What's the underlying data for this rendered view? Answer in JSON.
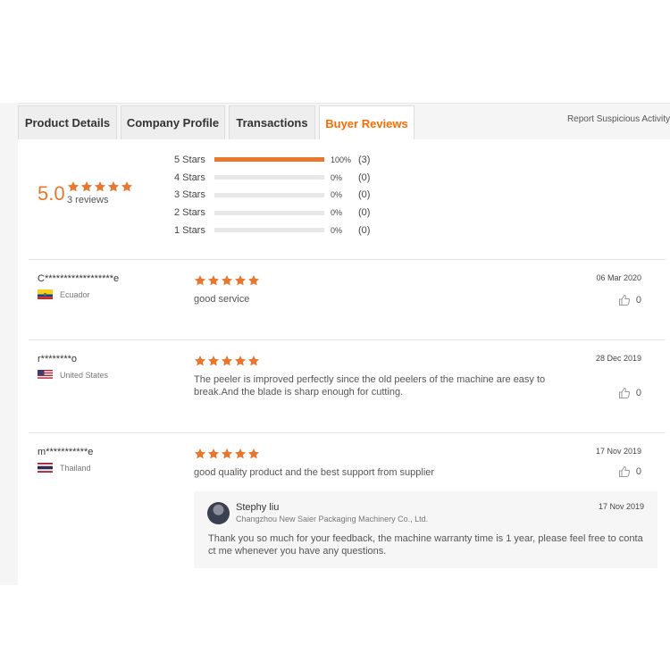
{
  "tabs": [
    {
      "label": "Product Details",
      "active": false
    },
    {
      "label": "Company Profile",
      "active": false
    },
    {
      "label": "Transactions",
      "active": false
    },
    {
      "label": "Buyer Reviews",
      "active": true
    }
  ],
  "report_link": "Report Suspicious Activity",
  "summary": {
    "score": "5.0",
    "rating": 5,
    "review_count": "3 reviews",
    "distribution": [
      {
        "label": "5  Stars",
        "fraction": 1.0,
        "percent": "100%",
        "count": "(3)"
      },
      {
        "label": "4  Stars",
        "fraction": 0.0,
        "percent": "0%",
        "count": "(0)"
      },
      {
        "label": "3  Stars",
        "fraction": 0.0,
        "percent": "0%",
        "count": "(0)"
      },
      {
        "label": "2  Stars",
        "fraction": 0.0,
        "percent": "0%",
        "count": "(0)"
      },
      {
        "label": "1  Stars",
        "fraction": 0.0,
        "percent": "0%",
        "count": "(0)"
      }
    ]
  },
  "reviews": [
    {
      "reviewer": "C******************e",
      "country": "Ecuador",
      "flag": "ecuador-flag",
      "rating": 5,
      "date": "06 Mar 2020",
      "text": "good service",
      "likes": "0"
    },
    {
      "reviewer": "r********o",
      "country": "United States",
      "flag": "united-states-flag",
      "rating": 5,
      "date": "28 Dec 2019",
      "text": "The peeler is improved perfectly since the old peelers of the machine are easy to break.And the blade is sharp enough for cutting.",
      "likes": "0"
    },
    {
      "reviewer": "m***********e",
      "country": "Thailand",
      "flag": "thailand-flag",
      "rating": 5,
      "date": "17 Nov 2019",
      "text": "good quality product and the best support from supplier",
      "likes": "0",
      "reply": {
        "name": "Stephy liu",
        "company": "Changzhou New Saier Packaging Machinery Co., Ltd.",
        "date": "17 Nov 2019",
        "text": "Thank you so much for your feedback, the machine warranty time is 1 year, please feel free to contact me whenever you have any questions."
      }
    }
  ],
  "colors": {
    "accent": "#ff6a00",
    "star": "#e8762c",
    "bar_track": "#e8e8e8"
  },
  "icons": {
    "star": "star-icon",
    "like": "thumbs-up-icon"
  }
}
